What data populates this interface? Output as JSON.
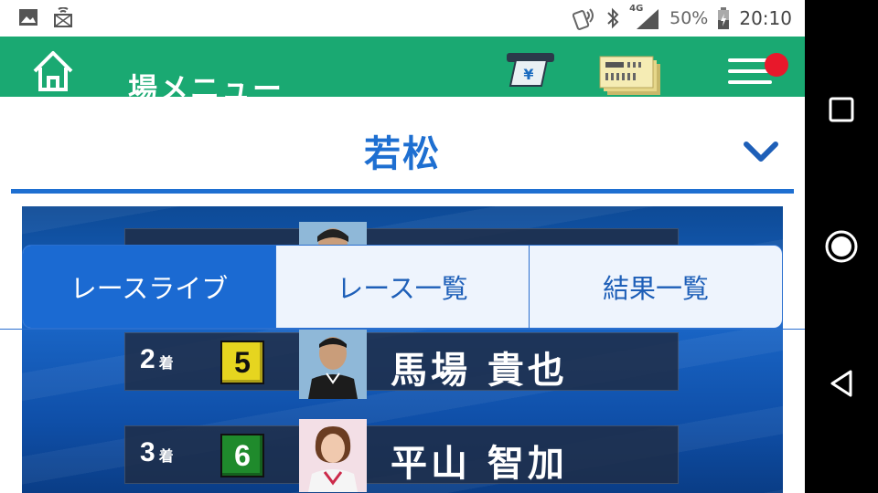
{
  "status_bar": {
    "battery_percent": "50%",
    "time": "20:10",
    "network": "4G",
    "icons": [
      "image-icon",
      "cast-icon",
      "nfc-icon",
      "bluetooth-icon",
      "signal-icon",
      "battery-icon"
    ]
  },
  "app_bar": {
    "title": "場メニュー",
    "atm_icon_label": "¥",
    "color": "#1aa972"
  },
  "venue": {
    "name": "若松",
    "accent": "#1e6fd1"
  },
  "tabs": [
    {
      "label": "レースライブ",
      "active": true
    },
    {
      "label": "レース一覧",
      "active": false
    },
    {
      "label": "結果一覧",
      "active": false
    }
  ],
  "results": [
    {
      "rank": "2",
      "suffix": "着",
      "lane": "5",
      "lane_bg": "#e6d51f",
      "lane_fg": "#111111",
      "name": "馬場 貴也"
    },
    {
      "rank": "3",
      "suffix": "着",
      "lane": "6",
      "lane_bg": "#1f8a2c",
      "lane_fg": "#ffffff",
      "name": "平山 智加"
    }
  ]
}
